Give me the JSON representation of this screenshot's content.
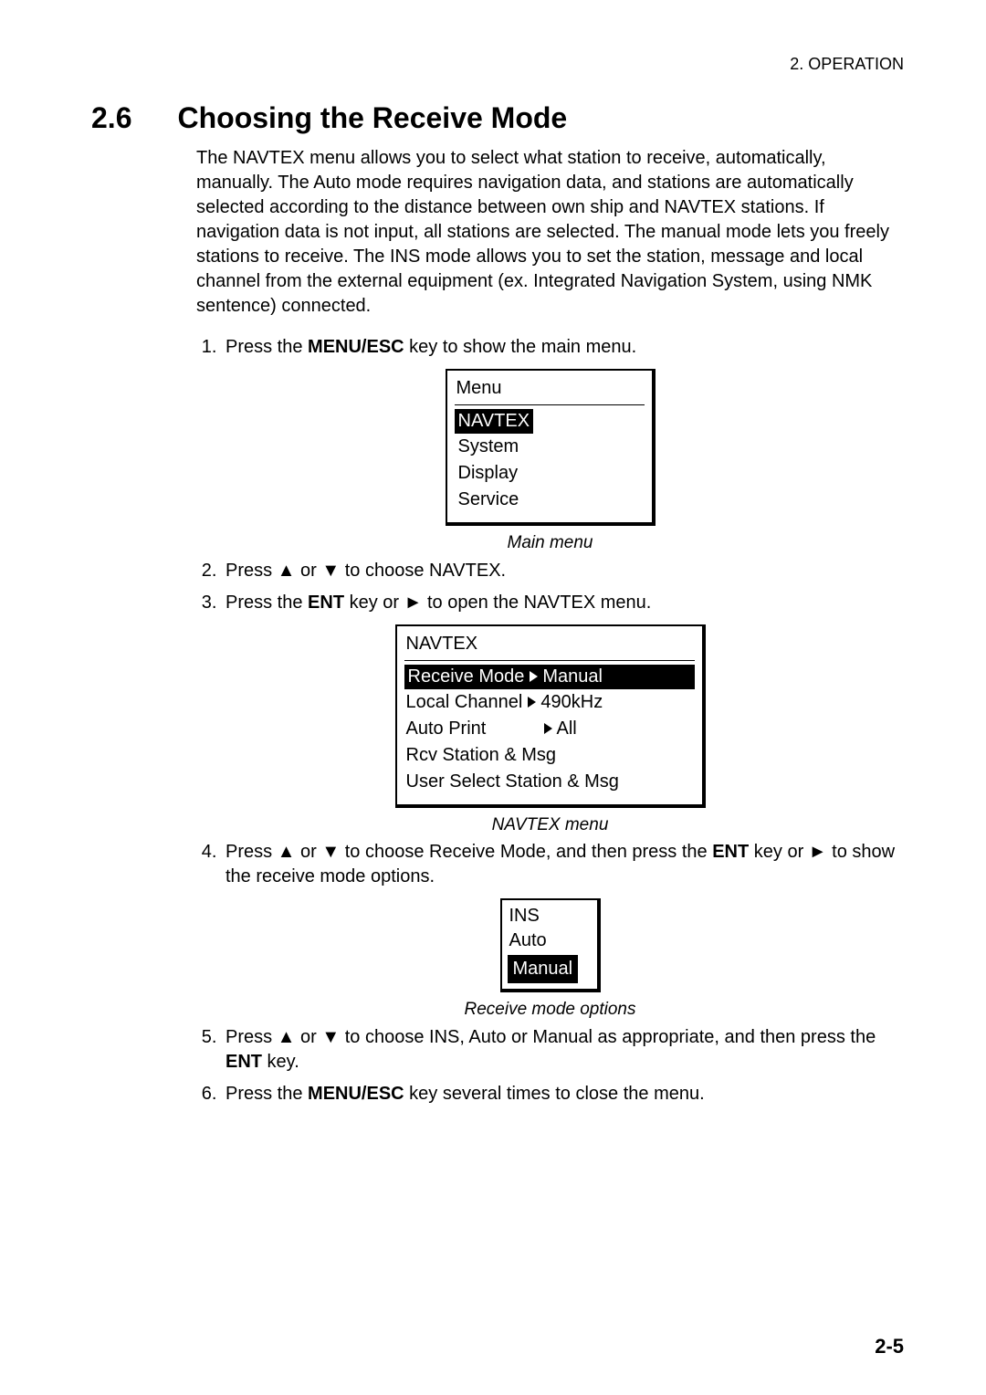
{
  "header": {
    "running": "2. OPERATION"
  },
  "section": {
    "number": "2.6",
    "title": "Choosing the Receive Mode"
  },
  "intro": "The NAVTEX menu allows you to select what station to receive, automatically, manually. The Auto mode requires navigation data, and stations are automatically selected according to the distance between own ship and NAVTEX stations. If navigation data is not input, all stations are selected. The manual mode lets you freely stations to receive. The INS mode allows you to set the station, message and local channel from the external equipment (ex. Integrated Navigation System, using NMK sentence) connected.",
  "steps": {
    "s1_a": "Press the ",
    "s1_b": "MENU/ESC",
    "s1_c": " key to show the main menu.",
    "s2": "Press ▲ or ▼ to choose NAVTEX.",
    "s3_a": "Press the ",
    "s3_b": "ENT",
    "s3_c": " key or ► to open the NAVTEX menu.",
    "s4_a": "Press ▲ or ▼ to choose Receive Mode, and then press the ",
    "s4_b": "ENT",
    "s4_c": " key or ► to show the receive mode options.",
    "s5_a": "Press ▲ or ▼ to choose INS, Auto or Manual as appropriate, and then press the ",
    "s5_b": "ENT",
    "s5_c": " key.",
    "s6_a": "Press the ",
    "s6_b": "MENU/ESC",
    "s6_c": " key several times to close the menu."
  },
  "main_menu": {
    "title": "Menu",
    "items": [
      "NAVTEX",
      "System",
      "Display",
      "Service"
    ],
    "caption": "Main menu"
  },
  "navtex_menu": {
    "title": "NAVTEX",
    "rows": [
      {
        "label": "Receive Mode",
        "value": "Manual",
        "hl": true
      },
      {
        "label": "Local Channel",
        "value": "490kHz",
        "hl": false
      },
      {
        "label": "Auto Print",
        "value": "All",
        "hl": false
      },
      {
        "label": "Rcv Station & Msg",
        "value": "",
        "hl": false
      },
      {
        "label": "User Select Station & Msg",
        "value": "",
        "hl": false
      }
    ],
    "caption": "NAVTEX menu"
  },
  "options": {
    "items": [
      "INS",
      "Auto",
      "Manual"
    ],
    "caption": "Receive mode options"
  },
  "page_number": "2-5"
}
